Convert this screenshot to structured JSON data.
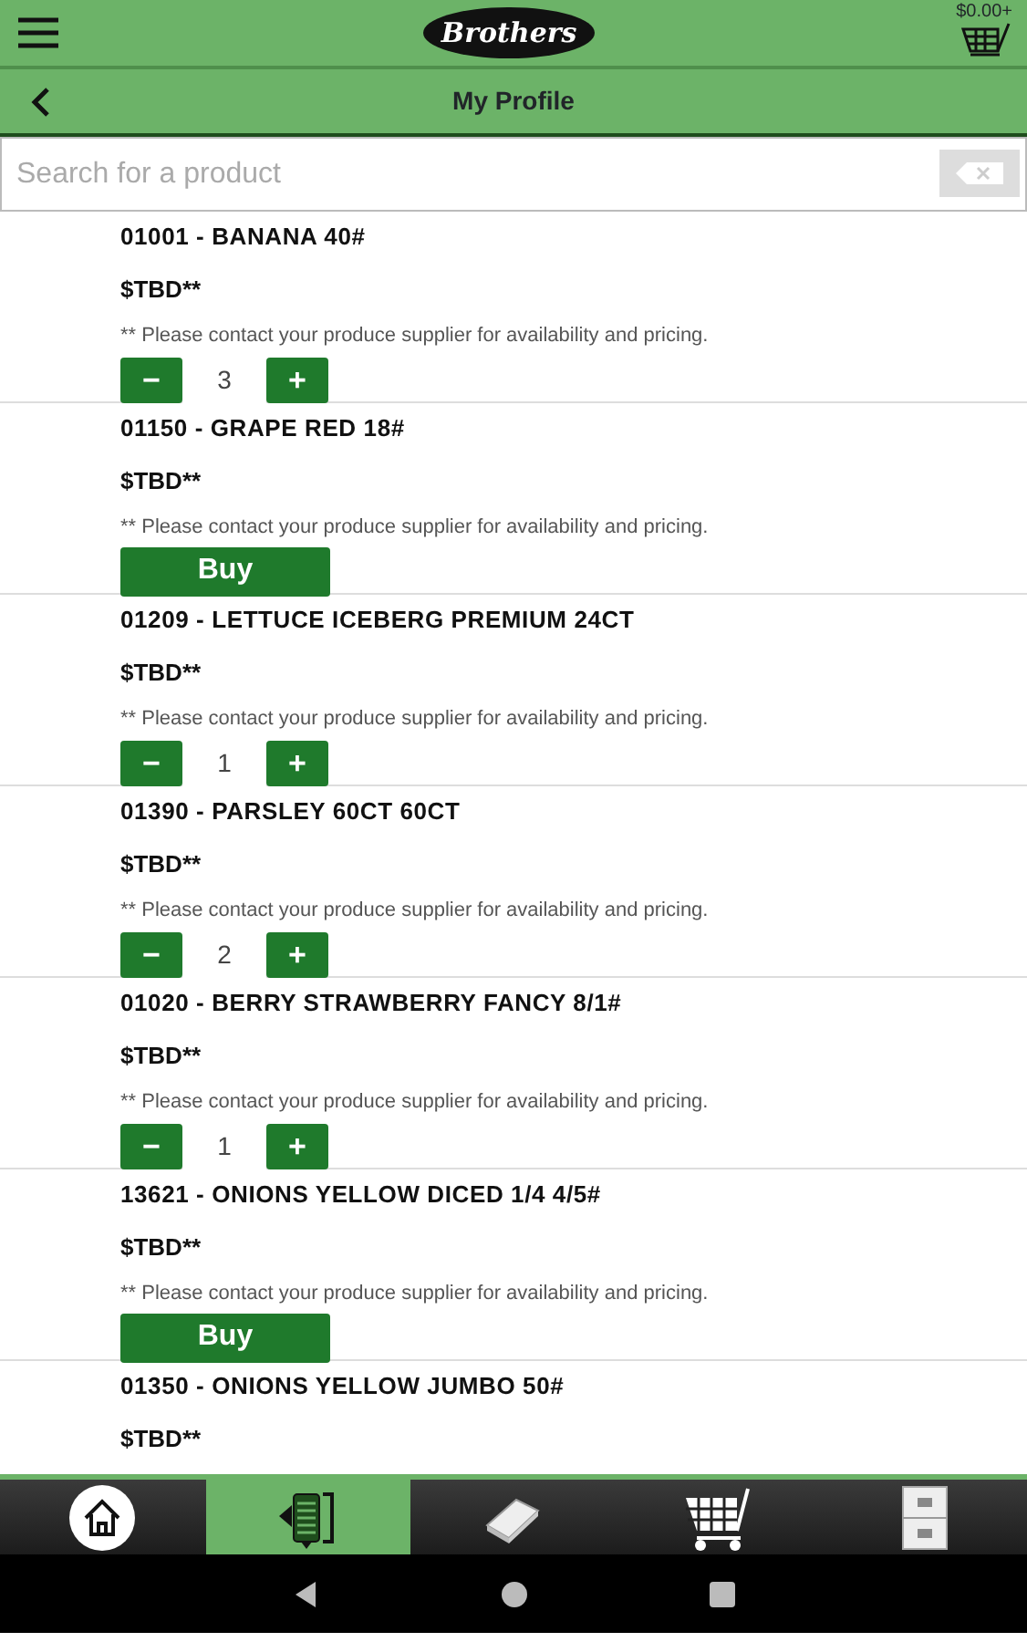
{
  "header": {
    "logo": "Brothers",
    "cart_total": "$0.00+"
  },
  "title_bar": {
    "title": "My Profile"
  },
  "search": {
    "placeholder": "Search for a product"
  },
  "products": [
    {
      "name": "01001 - BANANA 40#",
      "price": "$TBD**",
      "note": "** Please contact your produce supplier for availability and pricing.",
      "kind": "stepper",
      "quantity": "3",
      "minus": "−",
      "plus": "+"
    },
    {
      "name": "01150 - GRAPE RED 18#",
      "price": "$TBD**",
      "note": "** Please contact your produce supplier for availability and pricing.",
      "kind": "buy",
      "button": "Buy"
    },
    {
      "name": "01209 - LETTUCE ICEBERG PREMIUM 24CT",
      "price": "$TBD**",
      "note": "** Please contact your produce supplier for availability and pricing.",
      "kind": "stepper",
      "quantity": "1",
      "minus": "−",
      "plus": "+"
    },
    {
      "name": "01390 - PARSLEY 60CT 60CT",
      "price": "$TBD**",
      "note": "** Please contact your produce supplier for availability and pricing.",
      "kind": "stepper",
      "quantity": "2",
      "minus": "−",
      "plus": "+"
    },
    {
      "name": "01020 - BERRY STRAWBERRY FANCY 8/1#",
      "price": "$TBD**",
      "note": "** Please contact your produce supplier for availability and pricing.",
      "kind": "stepper",
      "quantity": "1",
      "minus": "−",
      "plus": "+"
    },
    {
      "name": "13621 - ONIONS YELLOW DICED 1/4 4/5#",
      "price": "$TBD**",
      "note": "** Please contact your produce supplier for availability and pricing.",
      "kind": "buy",
      "button": "Buy"
    },
    {
      "name": "01350 - ONIONS YELLOW JUMBO 50#",
      "price": "$TBD**"
    }
  ],
  "tabs": [
    {
      "kind": "home",
      "selected": false
    },
    {
      "kind": "order",
      "selected": true
    },
    {
      "kind": "catalog",
      "selected": false
    },
    {
      "kind": "cart",
      "selected": false
    },
    {
      "kind": "account",
      "selected": false
    }
  ]
}
